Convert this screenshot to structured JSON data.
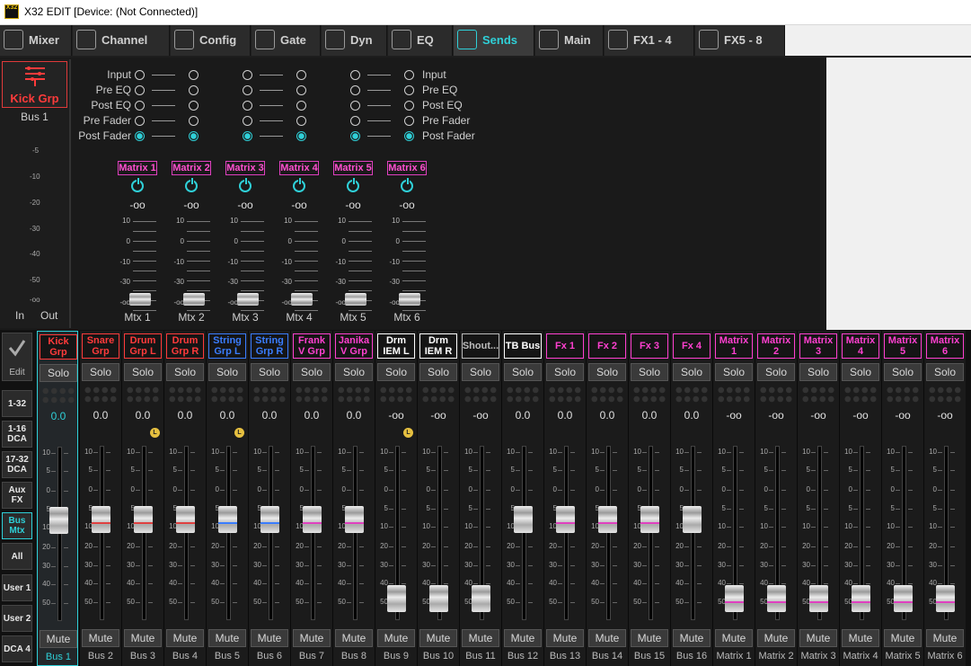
{
  "window": {
    "title": "X32 EDIT [Device: (Not Connected)]",
    "app_icon": "x32-edit-icon"
  },
  "tabs": [
    {
      "label": "Mixer",
      "icon": "mixer-icon"
    },
    {
      "label": "Channel",
      "icon": "channel-icon"
    },
    {
      "label": "Config",
      "icon": "config-icon"
    },
    {
      "label": "Gate",
      "icon": "gate-icon"
    },
    {
      "label": "Dyn",
      "icon": "dyn-icon"
    },
    {
      "label": "EQ",
      "icon": "eq-icon"
    },
    {
      "label": "Sends",
      "icon": "sends-icon",
      "active": true
    },
    {
      "label": "Main",
      "icon": "main-icon"
    },
    {
      "label": "FX1 - 4",
      "icon": "fx-icon"
    },
    {
      "label": "FX5 - 8",
      "icon": "fx-icon"
    }
  ],
  "selected": {
    "name": "Kick Grp",
    "bus": "Bus 1",
    "color": "#ff3b3b",
    "meter_scale": [
      "-5",
      "-10",
      "-20",
      "-30",
      "-40",
      "-50",
      "-oo"
    ],
    "in_label": "In",
    "out_label": "Out"
  },
  "sends": {
    "tap_labels_left": [
      "Input",
      "Pre EQ",
      "Post EQ",
      "Pre Fader",
      "Post Fader"
    ],
    "tap_labels_right": [
      "Input",
      "Pre EQ",
      "Post EQ",
      "Pre Fader",
      "Post Fader"
    ],
    "selected_tap": "Post Fader",
    "fader_scale": [
      "10",
      "0",
      "-10",
      "-30",
      "-oo"
    ],
    "matrices": [
      {
        "label": "Matrix 1",
        "value": "-oo",
        "name": "Mtx 1"
      },
      {
        "label": "Matrix 2",
        "value": "-oo",
        "name": "Mtx 2"
      },
      {
        "label": "Matrix 3",
        "value": "-oo",
        "name": "Mtx 3"
      },
      {
        "label": "Matrix 4",
        "value": "-oo",
        "name": "Mtx 4"
      },
      {
        "label": "Matrix 5",
        "value": "-oo",
        "name": "Mtx 5"
      },
      {
        "label": "Matrix 6",
        "value": "-oo",
        "name": "Mtx 6"
      }
    ]
  },
  "sidebar": {
    "edit_label": "Edit",
    "buttons": [
      "1-32",
      "1-16 DCA",
      "17-32 DCA",
      "Aux FX",
      "Bus Mtx",
      "All",
      "User 1",
      "User 2",
      "DCA 4"
    ],
    "selected": "Bus Mtx"
  },
  "strip_common": {
    "solo_label": "Solo",
    "mute_label": "Mute",
    "scale": [
      "10",
      "5",
      "0",
      "5",
      "10",
      "20",
      "30",
      "40",
      "50"
    ]
  },
  "strips": [
    {
      "name": "Kick Grp",
      "color": "#ff3b3b",
      "value": "0.0",
      "bus": "Bus 1",
      "fader_level": 0.72,
      "stripe": "",
      "lr": false,
      "selected": true
    },
    {
      "name": "Snare Grp",
      "color": "#ff3b3b",
      "value": "0.0",
      "bus": "Bus 2",
      "fader_level": 0.72,
      "stripe": "#e04040",
      "lr": false
    },
    {
      "name": "Drum Grp L",
      "color": "#ff3b3b",
      "value": "0.0",
      "bus": "Bus 3",
      "fader_level": 0.72,
      "stripe": "#e04040",
      "lr": true
    },
    {
      "name": "Drum Grp R",
      "color": "#ff3b3b",
      "value": "0.0",
      "bus": "Bus 4",
      "fader_level": 0.72,
      "stripe": "#e04040",
      "lr": false
    },
    {
      "name": "String Grp L",
      "color": "#3a7dff",
      "value": "0.0",
      "bus": "Bus 5",
      "fader_level": 0.72,
      "stripe": "#3a7dff",
      "lr": true
    },
    {
      "name": "String Grp R",
      "color": "#3a7dff",
      "value": "0.0",
      "bus": "Bus 6",
      "fader_level": 0.72,
      "stripe": "#3a7dff",
      "lr": false
    },
    {
      "name": "Frank V Grp",
      "color": "#ff40d0",
      "value": "0.0",
      "bus": "Bus 7",
      "fader_level": 0.72,
      "stripe": "#e040c0",
      "lr": false
    },
    {
      "name": "Janika V Grp",
      "color": "#ff40d0",
      "value": "0.0",
      "bus": "Bus 8",
      "fader_level": 0.72,
      "stripe": "#e040c0",
      "lr": false
    },
    {
      "name": "Drm IEM L",
      "color": "#ffffff",
      "value": "-oo",
      "bus": "Bus 9",
      "fader_level": 0.0,
      "stripe": "",
      "lr": true
    },
    {
      "name": "Drm IEM R",
      "color": "#ffffff",
      "value": "-oo",
      "bus": "Bus 10",
      "fader_level": 0.0,
      "stripe": "",
      "lr": false
    },
    {
      "name": "Shout...",
      "color": "#bbbbbb",
      "value": "-oo",
      "bus": "Bus 11",
      "fader_level": 0.0,
      "stripe": "",
      "lr": false
    },
    {
      "name": "TB Bus",
      "color": "#ffffff",
      "value": "0.0",
      "bus": "Bus 12",
      "fader_level": 0.72,
      "stripe": "",
      "lr": false
    },
    {
      "name": "Fx 1",
      "color": "#ff40d0",
      "value": "0.0",
      "bus": "Bus 13",
      "fader_level": 0.72,
      "stripe": "#e040c0",
      "lr": false
    },
    {
      "name": "Fx 2",
      "color": "#ff40d0",
      "value": "0.0",
      "bus": "Bus 14",
      "fader_level": 0.72,
      "stripe": "#e040c0",
      "lr": false
    },
    {
      "name": "Fx 3",
      "color": "#ff40d0",
      "value": "0.0",
      "bus": "Bus 15",
      "fader_level": 0.72,
      "stripe": "#e040c0",
      "lr": false
    },
    {
      "name": "Fx 4",
      "color": "#ff40d0",
      "value": "0.0",
      "bus": "Bus 16",
      "fader_level": 0.72,
      "stripe": "",
      "lr": false
    },
    {
      "name": "Matrix 1",
      "color": "#ff40d0",
      "value": "-oo",
      "bus": "Matrix 1",
      "fader_level": 0.0,
      "stripe": "#e040c0",
      "lr": false
    },
    {
      "name": "Matrix 2",
      "color": "#ff40d0",
      "value": "-oo",
      "bus": "Matrix 2",
      "fader_level": 0.0,
      "stripe": "#e040c0",
      "lr": false
    },
    {
      "name": "Matrix 3",
      "color": "#ff40d0",
      "value": "-oo",
      "bus": "Matrix 3",
      "fader_level": 0.0,
      "stripe": "#e040c0",
      "lr": false
    },
    {
      "name": "Matrix 4",
      "color": "#ff40d0",
      "value": "-oo",
      "bus": "Matrix 4",
      "fader_level": 0.0,
      "stripe": "#e040c0",
      "lr": false
    },
    {
      "name": "Matrix 5",
      "color": "#ff40d0",
      "value": "-oo",
      "bus": "Matrix 5",
      "fader_level": 0.0,
      "stripe": "#e040c0",
      "lr": false
    },
    {
      "name": "Matrix 6",
      "color": "#ff40d0",
      "value": "-oo",
      "bus": "Matrix 6",
      "fader_level": 0.0,
      "stripe": "#e040c0",
      "lr": false
    }
  ]
}
